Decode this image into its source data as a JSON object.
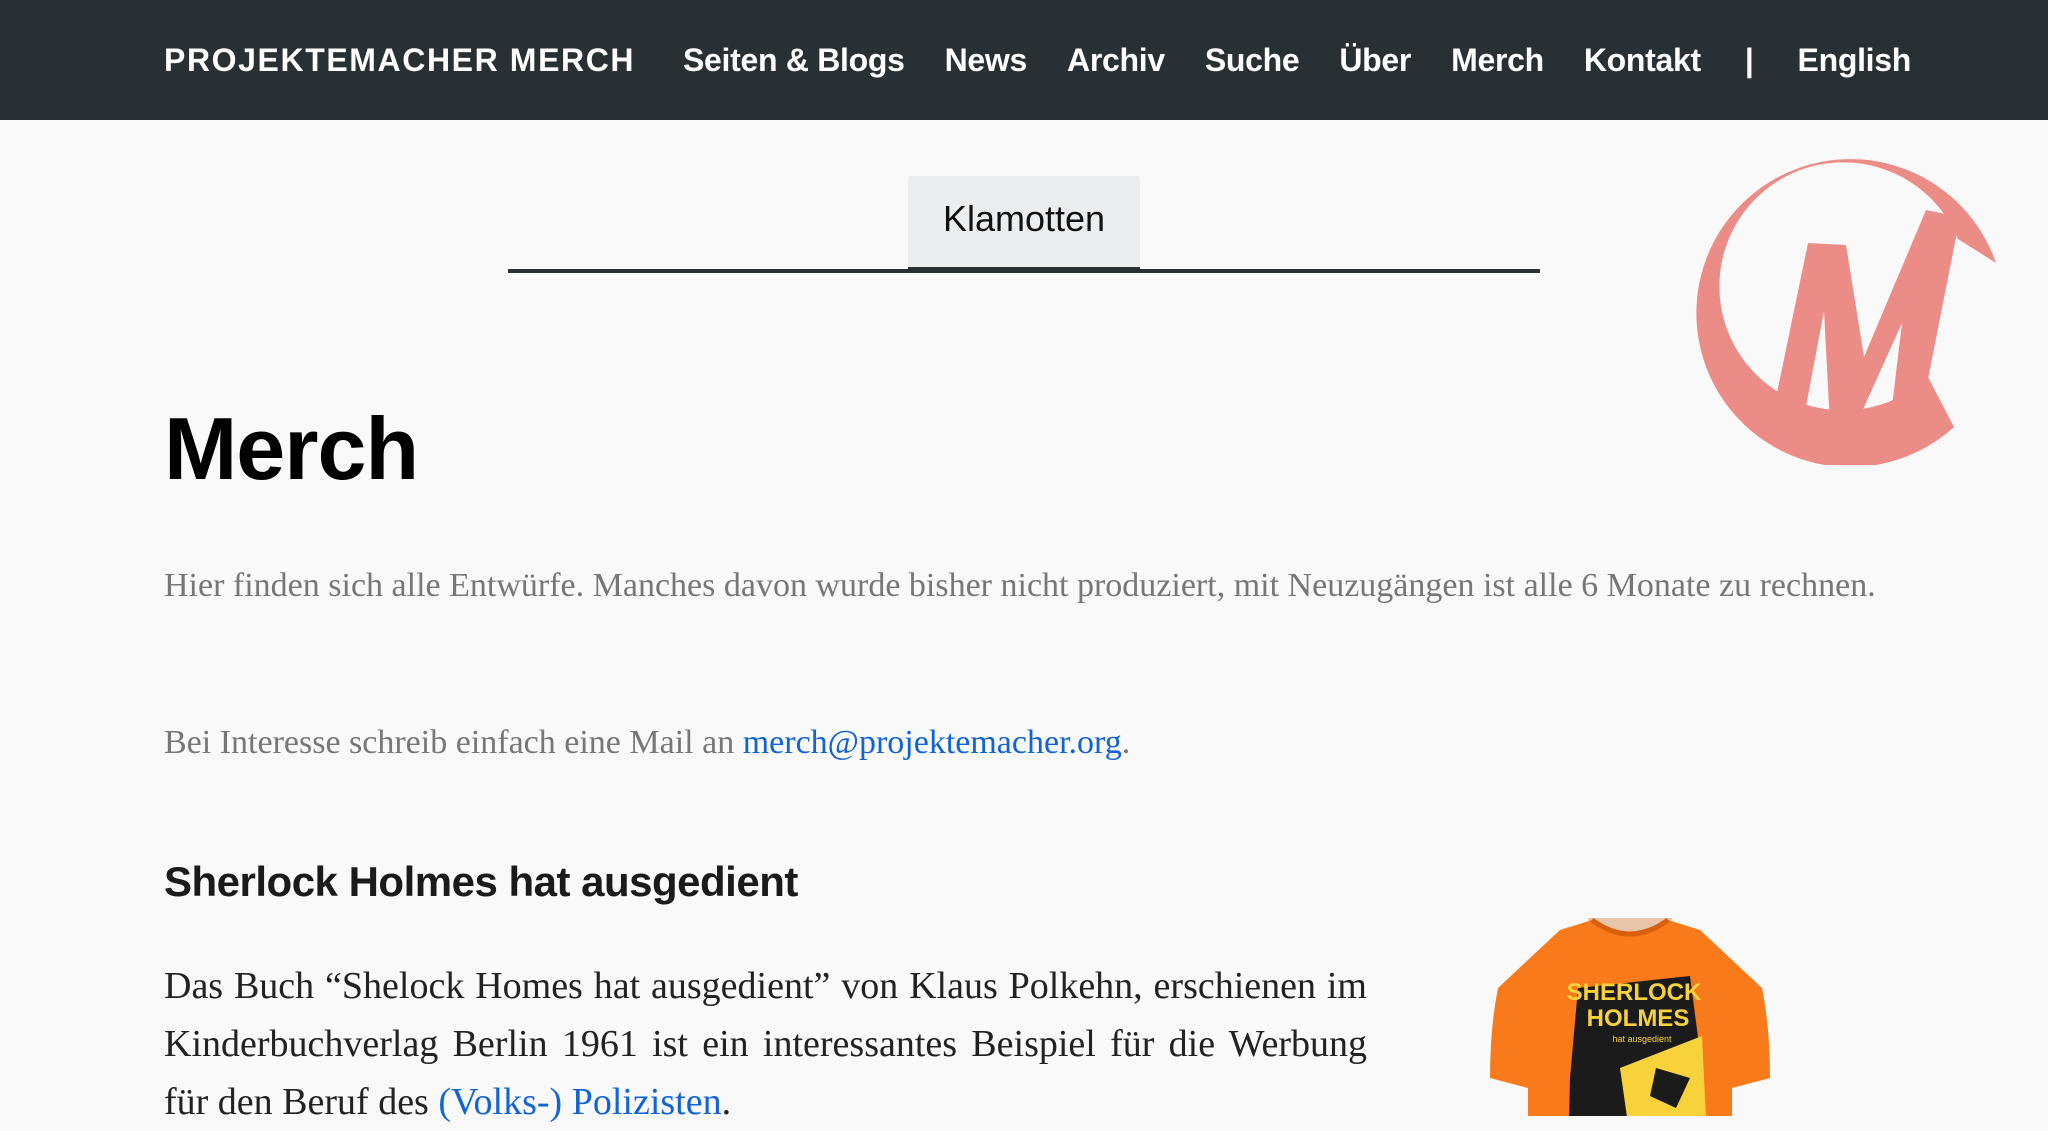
{
  "site": {
    "brand": "PROJEKTEMACHER MERCH",
    "nav": [
      "Seiten & Blogs",
      "News",
      "Archiv",
      "Suche",
      "Über",
      "Merch",
      "Kontakt"
    ],
    "separator": "|",
    "language_link": "English"
  },
  "tabs": {
    "active": "Klamotten"
  },
  "page": {
    "title": "Merch",
    "intro_line": "Hier finden sich alle Entwürfe. Manches davon wurde bisher nicht produziert, mit Neuzugängen ist alle 6 Monate zu rechnen.",
    "contact_prefix": "Bei Interesse schreib einfach eine Mail an ",
    "contact_email": "merch@projektemacher.org",
    "contact_suffix": "."
  },
  "section": {
    "title": "Sherlock Holmes hat ausgedient",
    "text_before_link": "Das Buch “Shelock Homes hat ausgedient” von Klaus Polkehn, erschienen im Kinderbuchverlag Berlin 1961 ist ein interessantes Beispiel für die Werbung für den Beruf des ",
    "link_text": "(Volks-) Polizisten",
    "text_after_link": ".",
    "shirt_line1": "SHERLOCK",
    "shirt_line2": "HOLMES",
    "shirt_line3": "hat ausgedient"
  },
  "colors": {
    "nav_background": "#283033",
    "logo": "#ec8c86",
    "link": "#1163d6",
    "shirt": "#f97a1a"
  }
}
